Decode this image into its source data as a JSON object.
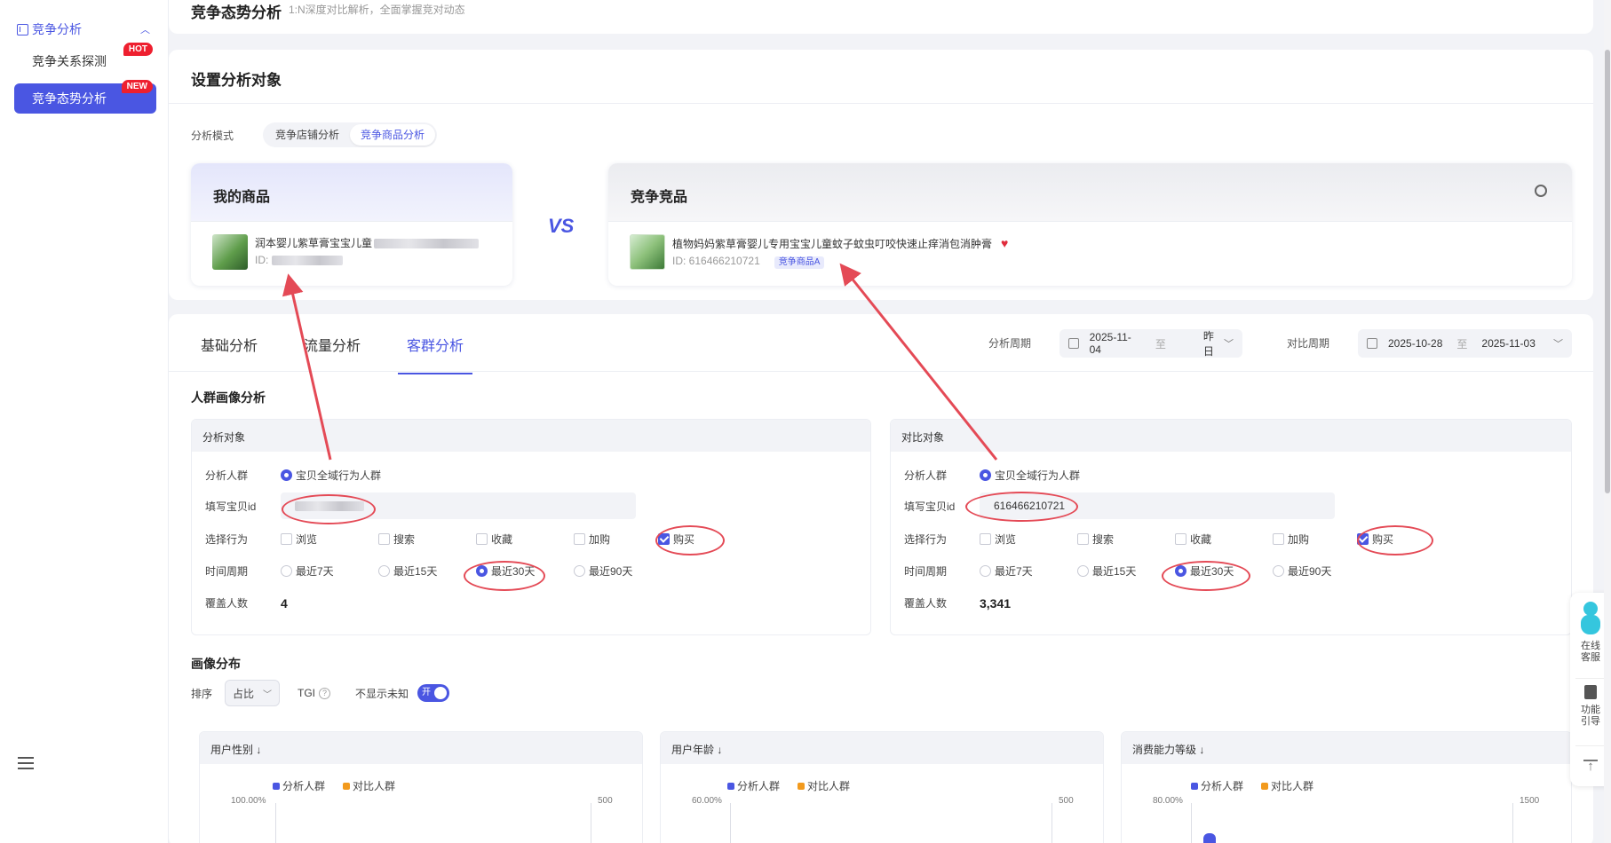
{
  "sidebar": {
    "group_label": "竞争分析",
    "items": [
      {
        "label": "竞争关系探测",
        "badge": "HOT"
      },
      {
        "label": "竞争态势分析",
        "badge": "NEW"
      }
    ]
  },
  "header": {
    "title": "竞争态势分析",
    "subtitle": "1:N深度对比解析，全面掌握竞对动态"
  },
  "setup": {
    "title": "设置分析对象",
    "mode_label": "分析模式",
    "modes": [
      "竞争店铺分析",
      "竞争商品分析"
    ],
    "my_product": {
      "heading": "我的商品",
      "name": "润本婴儿紫草膏宝宝儿童",
      "id_prefix": "ID:"
    },
    "vs": "VS",
    "competitor": {
      "heading": "竞争竞品",
      "name": "植物妈妈紫草膏婴儿专用宝宝儿童蚊子蚊虫叮咬快速止痒消包消肿膏",
      "id": "ID: 616466210721",
      "tag": "竞争商品A"
    }
  },
  "analysis": {
    "tabs": [
      "基础分析",
      "流量分析",
      "客群分析"
    ],
    "period_label": "分析周期",
    "period": {
      "start": "2025-11-04",
      "sep": "至",
      "end": "昨日"
    },
    "compare_label": "对比周期",
    "compare": {
      "start": "2025-10-28",
      "sep": "至",
      "end": "2025-11-03"
    },
    "section_title": "人群画像分析",
    "left_panel": {
      "title": "分析对象",
      "crowd_label": "分析人群",
      "crowd_value": "宝贝全域行为人群",
      "id_label": "填写宝贝id",
      "id_value": "",
      "behavior_label": "选择行为",
      "behaviors": [
        "浏览",
        "搜索",
        "收藏",
        "加购",
        "购买"
      ],
      "period_label": "时间周期",
      "periods": [
        "最近7天",
        "最近15天",
        "最近30天",
        "最近90天"
      ],
      "cover_label": "覆盖人数",
      "cover_value": "4"
    },
    "right_panel": {
      "title": "对比对象",
      "crowd_label": "分析人群",
      "crowd_value": "宝贝全域行为人群",
      "id_label": "填写宝贝id",
      "id_value": "616466210721",
      "behavior_label": "选择行为",
      "behaviors": [
        "浏览",
        "搜索",
        "收藏",
        "加购",
        "购买"
      ],
      "period_label": "时间周期",
      "periods": [
        "最近7天",
        "最近15天",
        "最近30天",
        "最近90天"
      ],
      "cover_label": "覆盖人数",
      "cover_value": "3,341"
    },
    "portrait": {
      "title": "画像分布",
      "sort_label": "排序",
      "sort_value": "占比",
      "tgi_label": "TGI",
      "unknown_label": "不显示未知",
      "toggle_text": "开"
    },
    "charts": [
      {
        "title": "用户性别 ↓",
        "legend": [
          "分析人群",
          "对比人群"
        ],
        "y_left_top": "100.00%",
        "y_right_top": "500"
      },
      {
        "title": "用户年龄 ↓",
        "legend": [
          "分析人群",
          "对比人群"
        ],
        "y_left_top": "60.00%",
        "y_right_top": "500"
      },
      {
        "title": "消费能力等级 ↓",
        "legend": [
          "分析人群",
          "对比人群"
        ],
        "y_left_top": "80.00%",
        "y_right_top": "1500"
      }
    ]
  },
  "float_bar": {
    "service": "在线客服",
    "guide": "功能引导"
  },
  "colors": {
    "accent": "#4a56e2",
    "series_a": "#4a56e2",
    "series_b": "#f29a1d",
    "annotation": "#e44a56"
  }
}
